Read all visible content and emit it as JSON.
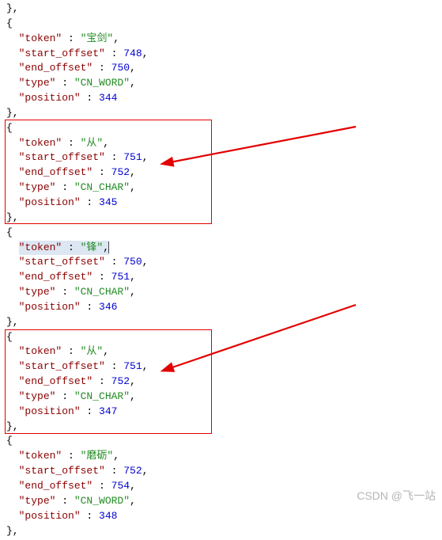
{
  "keys": {
    "token": "\"token\"",
    "start_offset": "\"start_offset\"",
    "end_offset": "\"end_offset\"",
    "type": "\"type\"",
    "position": "\"position\""
  },
  "blocks": {
    "b0": {
      "token": "\"宝剑\"",
      "start": "748",
      "end": "750",
      "type": "\"CN_WORD\"",
      "pos": "344"
    },
    "b1": {
      "token": "\"从\"",
      "start": "751",
      "end": "752",
      "type": "\"CN_CHAR\"",
      "pos": "345"
    },
    "b2": {
      "token": "\"锋\"",
      "start": "750",
      "end": "751",
      "type": "\"CN_CHAR\"",
      "pos": "346"
    },
    "b3": {
      "token": "\"从\"",
      "start": "751",
      "end": "752",
      "type": "\"CN_CHAR\"",
      "pos": "347"
    },
    "b4": {
      "token": "\"磨砺\"",
      "start": "752",
      "end": "754",
      "type": "\"CN_WORD\"",
      "pos": "348"
    }
  },
  "sep": " : ",
  "watermark": "CSDN @飞一站"
}
